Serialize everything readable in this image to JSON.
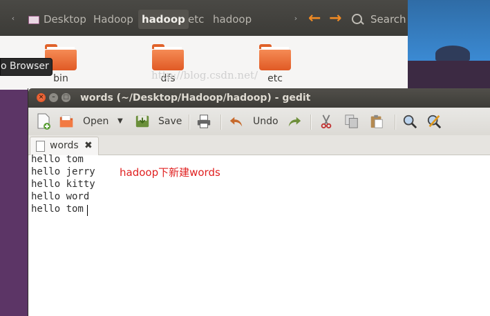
{
  "file_manager": {
    "breadcrumbs": [
      "Desktop",
      "Hadoop",
      "hadoop",
      "etc",
      "hadoop"
    ],
    "active_crumb_index": 2,
    "search_label": "Search",
    "folders": [
      "bin",
      "dfs",
      "etc"
    ],
    "tooltip_text": "o Browser"
  },
  "gedit": {
    "title": "words (~/Desktop/Hadoop/hadoop) - gedit",
    "toolbar": {
      "open_label": "Open",
      "save_label": "Save",
      "undo_label": "Undo"
    },
    "tab_label": "words",
    "lines": [
      "hello tom",
      "hello jerry",
      "hello kitty",
      "hello word",
      "hello tom"
    ],
    "watermark": "http://blog.csdn.net/",
    "annotation": "hadoop下新建words"
  },
  "colors": {
    "accent_orange": "#f08a24",
    "annotation_red": "#e02020",
    "folder_orange": "#e05a25"
  }
}
